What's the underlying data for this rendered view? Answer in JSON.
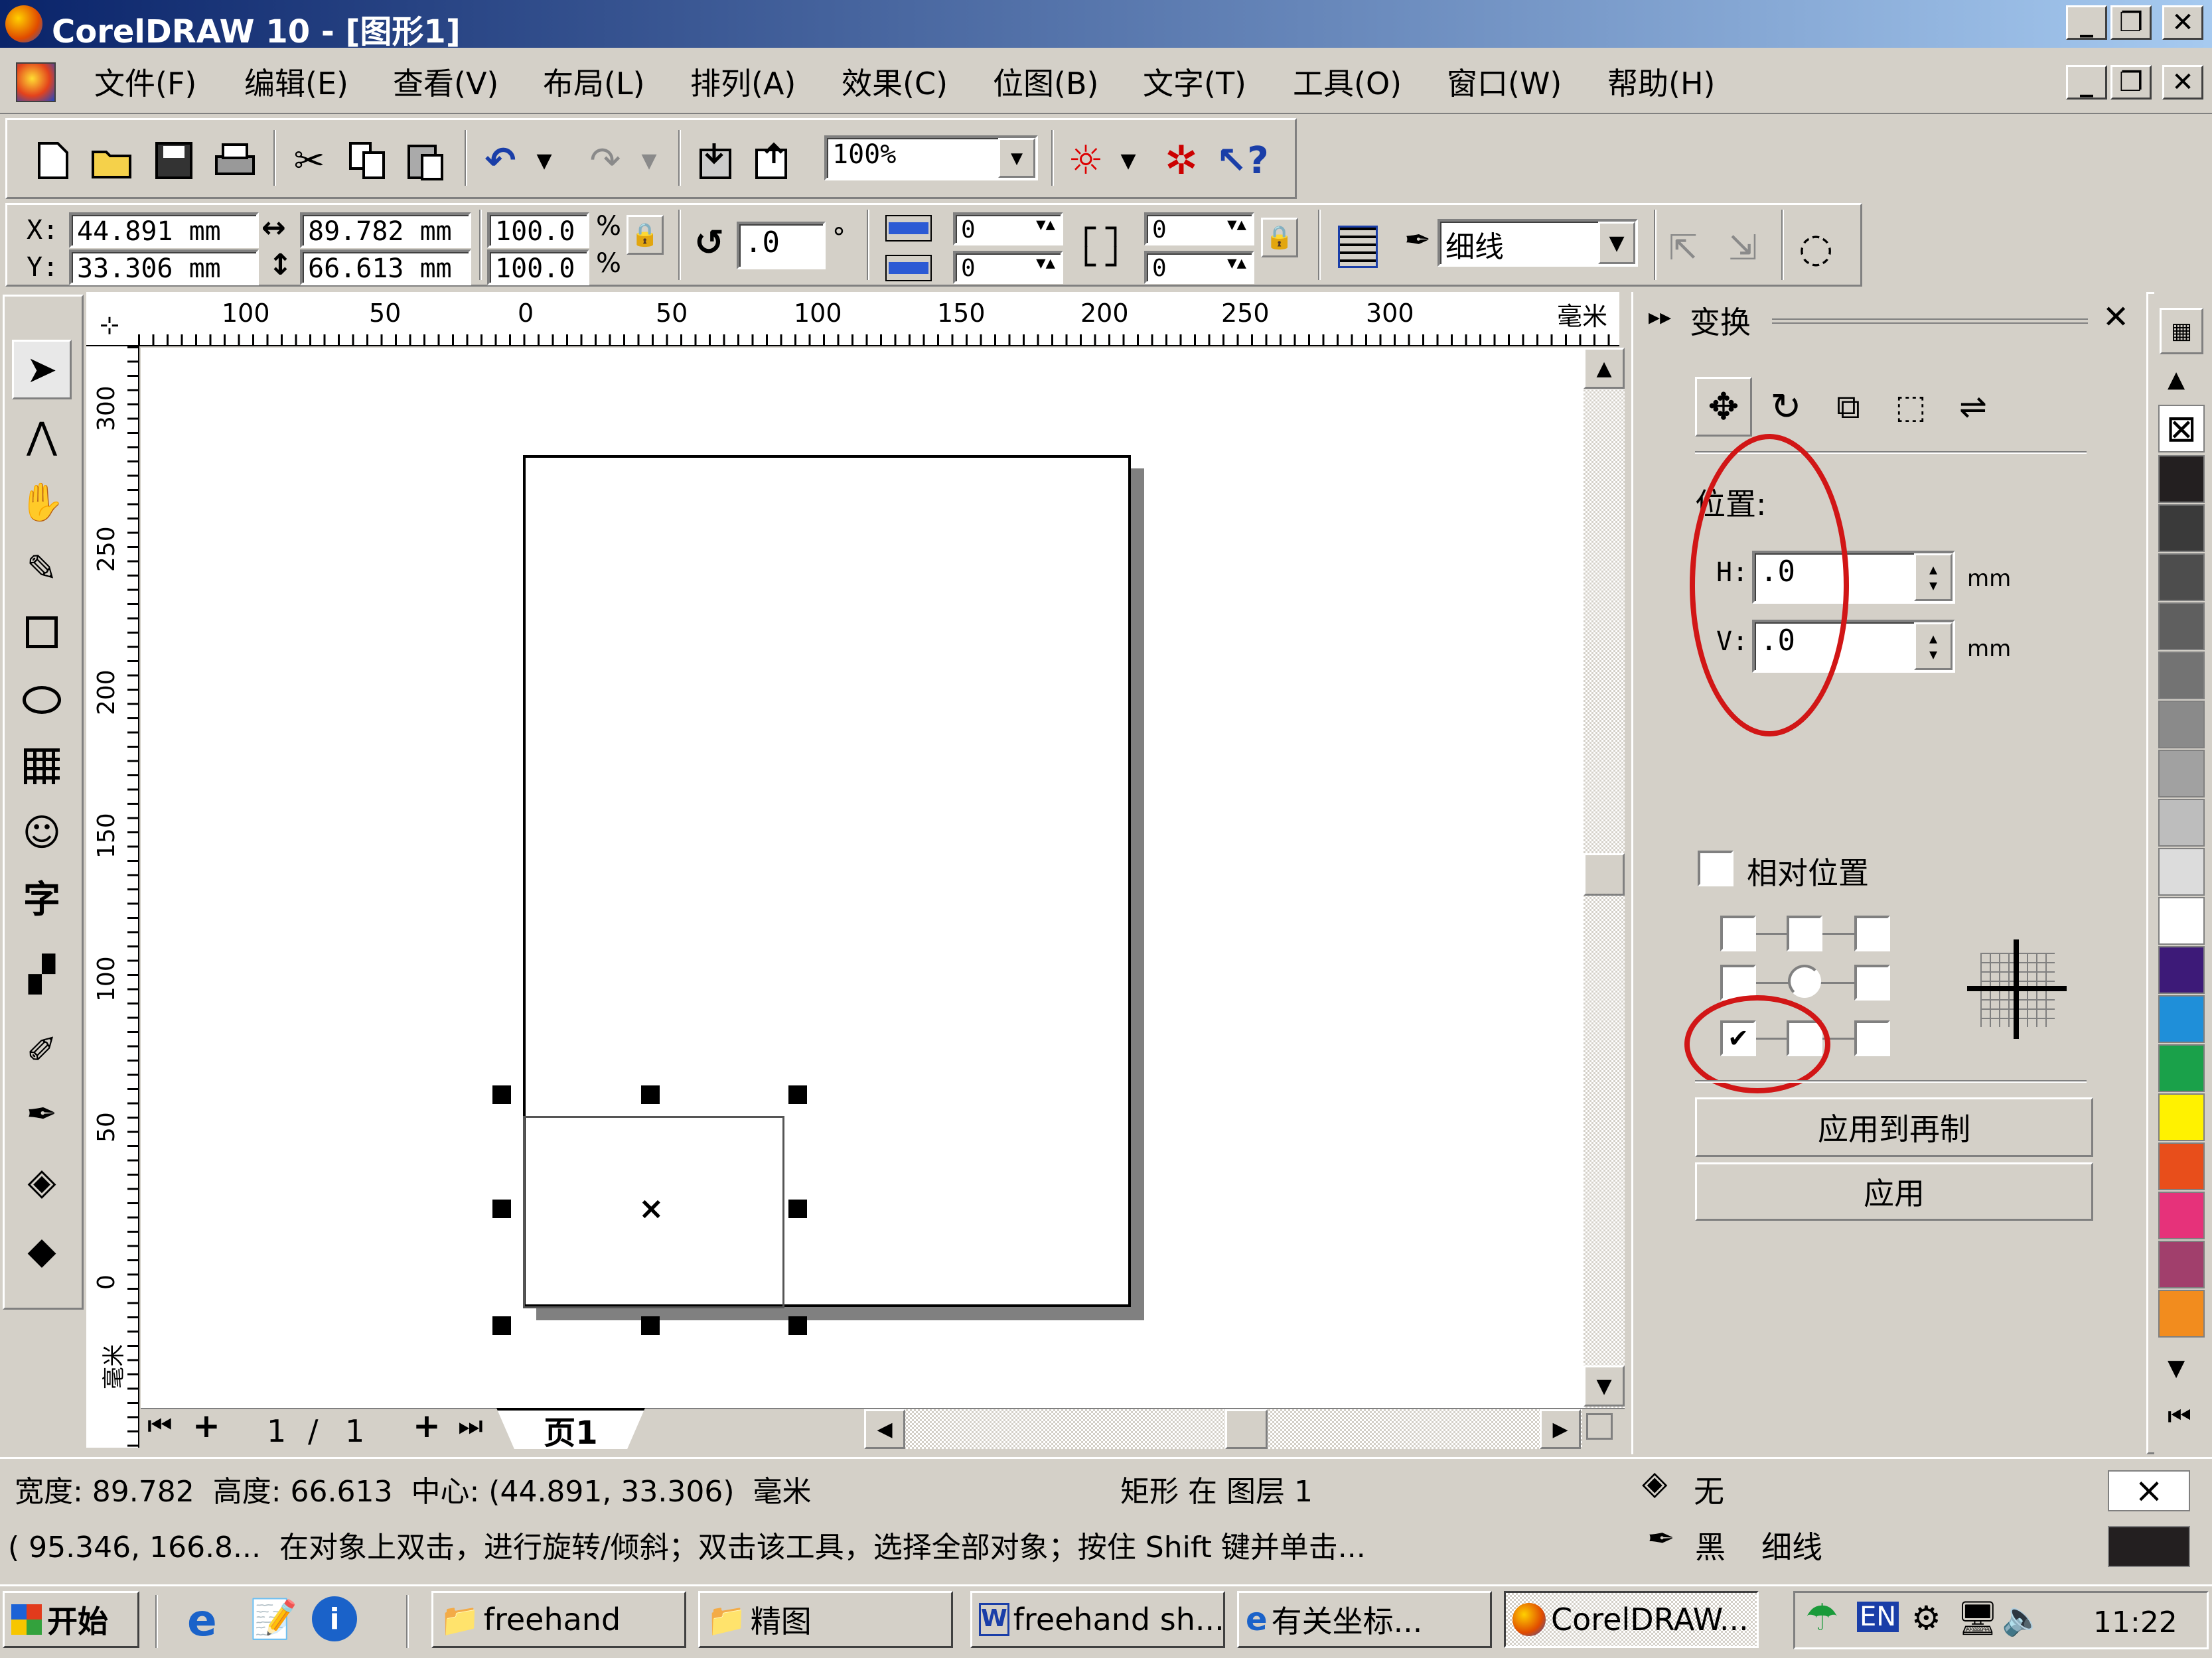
{
  "window": {
    "title": "CorelDRAW 10 - [图形1]",
    "minimize": "_",
    "restore": "❐",
    "close": "✕"
  },
  "menu": [
    "文件(F)",
    "编辑(E)",
    "查看(V)",
    "布局(L)",
    "排列(A)",
    "效果(C)",
    "位图(B)",
    "文字(T)",
    "工具(O)",
    "窗口(W)",
    "帮助(H)"
  ],
  "toolbar": {
    "zoom": "100%"
  },
  "property_bar": {
    "x_label": "X:",
    "y_label": "Y:",
    "x": "44.891 mm",
    "y": "33.306 mm",
    "width": "89.782 mm",
    "height": "66.613 mm",
    "scale_x": "100.0",
    "scale_y": "100.0",
    "percent": "%",
    "rotation": ".0",
    "degree": "°",
    "corner_tl": "0",
    "corner_bl": "0",
    "corner_tr": "0",
    "corner_br": "0",
    "outline": "细线"
  },
  "ruler": {
    "h_ticks": [
      "100",
      "50",
      "0",
      "50",
      "100",
      "150",
      "200",
      "250",
      "300"
    ],
    "unit": "毫米",
    "v_ticks": [
      "300",
      "250",
      "200",
      "150",
      "100",
      "50",
      "0"
    ],
    "v_unit": "毫米"
  },
  "page_nav": {
    "current": "1",
    "separator": "/",
    "total": "1",
    "tab": "页1"
  },
  "docker": {
    "title": "变换",
    "position_label": "位置:",
    "h_label": "H:",
    "h_value": ".0",
    "v_label": "V:",
    "v_value": ".0",
    "unit": "mm",
    "relative_label": "相对位置",
    "apply_copy": "应用到再制",
    "apply": "应用"
  },
  "status": {
    "line1": "宽度: 89.782  高度: 66.613  中心: (44.891, 33.306)  毫米",
    "object_info": "矩形 在 图层 1",
    "fill_label": "无",
    "line2": "( 95.346, 166.8...  在对象上双击，进行旋转/倾斜；双击该工具，选择全部对象；按住 Shift 键并单击...",
    "outline_color": "黑",
    "outline_width": "细线"
  },
  "taskbar": {
    "start": "开始",
    "items": [
      "freehand",
      "精图",
      "freehand sh...",
      "有关坐标...",
      "CorelDRAW..."
    ],
    "lang": "EN",
    "time": "11:22"
  },
  "palette": [
    "#231f20",
    "#3a3a3a",
    "#4d4d4d",
    "#5f5f5f",
    "#737373",
    "#8a8a8a",
    "#a1a1a1",
    "#bdbdbd",
    "#dcdcdc",
    "#ffffff",
    "#3d1a78",
    "#1f8fd9",
    "#1aa14a",
    "#fff200",
    "#e84e1b",
    "#e6327a",
    "#a13f6c",
    "#f28c1e"
  ],
  "colors": {
    "titlebar_start": "#0a246a",
    "titlebar_end": "#a6caf0",
    "annotation": "#d11616"
  }
}
